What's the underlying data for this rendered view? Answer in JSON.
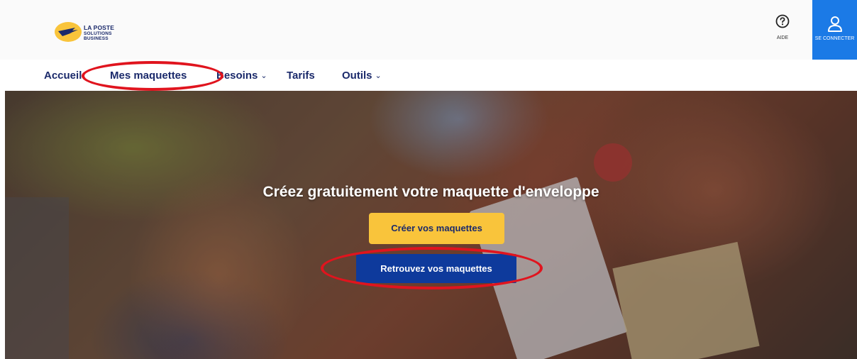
{
  "header": {
    "logo": {
      "line1": "LA POSTE",
      "line2": "SOLUTIONS",
      "line3": "BUSINESS",
      "icon": "la-poste-bird-icon",
      "colors": {
        "yellow": "#f9c43b",
        "navy": "#1b2a6b"
      }
    },
    "aide": {
      "label": "AIDE",
      "icon": "question-circle-icon"
    },
    "connect": {
      "label": "SE CONNECTER",
      "icon": "user-icon",
      "color": "#1b7ae6"
    }
  },
  "nav": {
    "items": [
      {
        "label": "Accueil",
        "chevron": ""
      },
      {
        "label": "Mes maquettes",
        "chevron": ""
      },
      {
        "label": "Besoins",
        "chevron": "⌄"
      },
      {
        "label": "Tarifs",
        "chevron": ""
      },
      {
        "label": "Outils",
        "chevron": "⌄"
      }
    ]
  },
  "hero": {
    "title": "Créez gratuitement votre maquette d'enveloppe",
    "primary_button": "Créer vos maquettes",
    "secondary_button": "Retrouvez vos maquettes"
  },
  "colors": {
    "primary_yellow": "#f9c43b",
    "primary_blue": "#0e3a9c",
    "nav_text": "#1b2a6b",
    "annotation_red": "#e0141e"
  }
}
